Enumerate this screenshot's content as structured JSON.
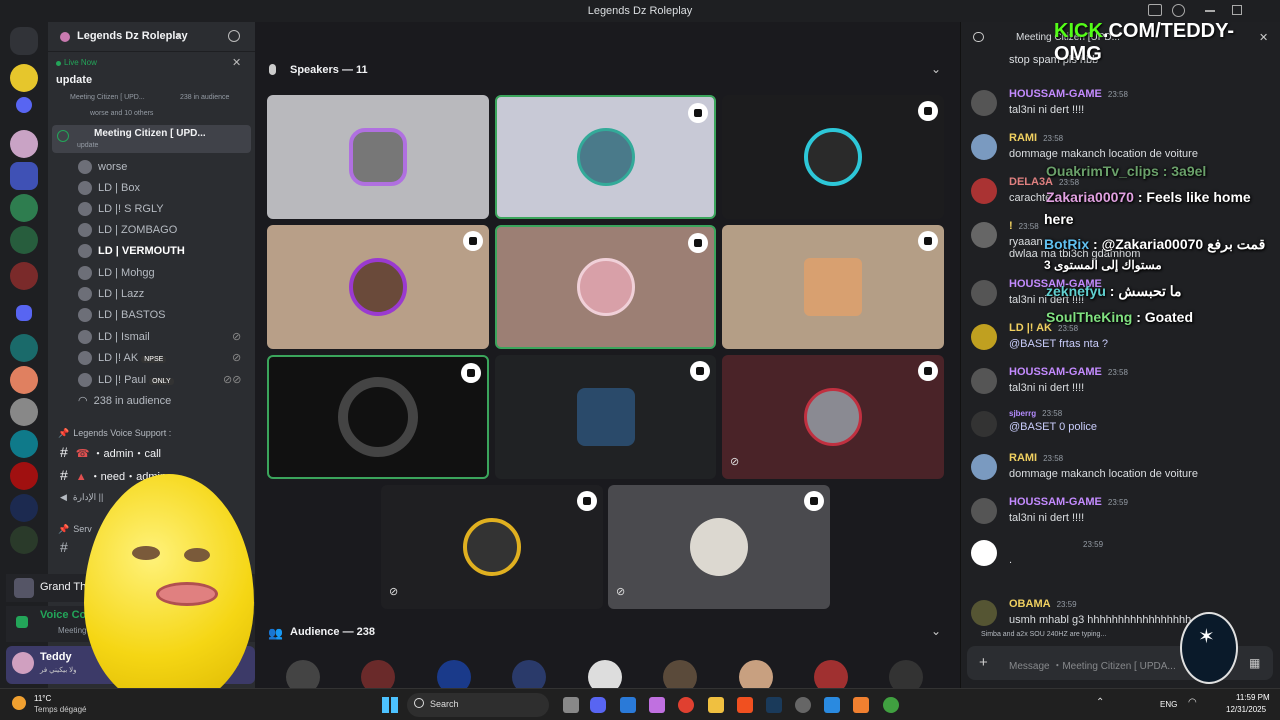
{
  "window": {
    "title": "Legends Dz Roleplay"
  },
  "sidebar": {
    "server_name": "Legends Dz Roleplay",
    "live_now": "Live Now",
    "event_title": "update",
    "event_sub": "Meeting Citizen [ UPD...",
    "event_audience": "238 in audience",
    "event_attendees": "worse and 10 others",
    "stage_channel": "Meeting Citizen [ UPD...",
    "stage_sub": "update",
    "members": [
      "worse",
      "LD | Box",
      "LD |! S RGLY",
      "LD | ZOMBAGO",
      "LD | VERMOUTH",
      "LD | Mohgg",
      "LD | Lazz",
      "LD | BASTOS",
      "LD | Ismail",
      "LD |! AK",
      "LD |! Paul"
    ],
    "npse": "NPSE",
    "only": "ONLY",
    "audience": "238 in audience",
    "category": "Legends Voice Support :",
    "admin_call": "・admin・call",
    "need_admin": "・need・admin",
    "idara": "الإدارة ||",
    "serv": "Serv",
    "grand_theft": "Grand Th",
    "voice_conn": "Voice Con",
    "voice_sub": "Meeting",
    "user_name": "Teddy",
    "user_status": "ولا بيكيني فر"
  },
  "main": {
    "speakers_label": "Speakers — 11",
    "audience_label": "Audience — 238"
  },
  "chat": {
    "header": "Meeting Citizen [UPD...",
    "messages": [
      {
        "name": "",
        "text": "stop spam pls hbb",
        "time": "",
        "color": "#fff"
      },
      {
        "name": "HOUSSAM-GAME",
        "text": "tal3ni ni dert !!!!",
        "time": "23:58",
        "color": "#c48bff"
      },
      {
        "name": "RAMI",
        "text": "dommage makanch location de voiture",
        "time": "23:58",
        "color": "#f0d060"
      },
      {
        "name": "DELA3A",
        "text": "carachte",
        "time": "23:58",
        "color": "#e08080"
      },
      {
        "name": "!",
        "text": "ryaaan",
        "time": "23:58",
        "color": "#f0d060"
      },
      {
        "name": "",
        "text": "dwlaa ma tbi3ch gdamhom",
        "time": "",
        "color": "#fff"
      },
      {
        "name": "HOUSSAM-GAME",
        "text": "tal3ni ni dert !!!!",
        "time": "",
        "color": "#c48bff"
      },
      {
        "name": "LD |! AK",
        "text": "@BASET frtas nta ?",
        "time": "23:58",
        "color": "#f0d060"
      },
      {
        "name": "HOUSSAM-GAME",
        "text": "tal3ni ni dert !!!!",
        "time": "23:58",
        "color": "#c48bff"
      },
      {
        "name": "sjberrg",
        "text": "@BASET 0 police",
        "time": "23:58",
        "color": "#b58cff"
      },
      {
        "name": "RAMI",
        "text": "dommage makanch location de voiture",
        "time": "23:58",
        "color": "#f0d060"
      },
      {
        "name": "HOUSSAM-GAME",
        "text": "tal3ni ni dert !!!!",
        "time": "23:59",
        "color": "#c48bff"
      },
      {
        "name": "",
        "text": ".",
        "time": "23:59",
        "color": "#fff"
      },
      {
        "name": "OBAMA",
        "text": "usmh mhabl g3 hhhhhhhhhhhhhhhhh",
        "time": "23:59",
        "color": "#f0d060"
      }
    ],
    "typing": "Simba and a2x SOU 240HZ are typing...",
    "input_placeholder": "Message  ・Meeting Citizen [ UPDA..."
  },
  "overlay": {
    "kick": "KICK",
    "kick_url": ".COM/TEDDY-OMG",
    "o1": "OuakrimTv_clips : 3a9el",
    "o2_name": "Zakaria00070",
    "o2_text": " : Feels like home",
    "o2_cont": "here",
    "o3_name": "BotRix",
    "o3_text": " : @Zakaria00070 قمت برفع",
    "o3_cont": "مستواك إلى المستوى 3",
    "o4_name": "zeknefyu",
    "o4_text": " : ما تحبسش",
    "o5_name": "SoulTheKing",
    "o5_text": " : Goated"
  },
  "taskbar": {
    "weather_temp": "11°C",
    "weather_desc": "Temps dégagé",
    "search": "Search",
    "lang": "ENG",
    "time": "11:59 PM",
    "date": "12/31/2025"
  }
}
